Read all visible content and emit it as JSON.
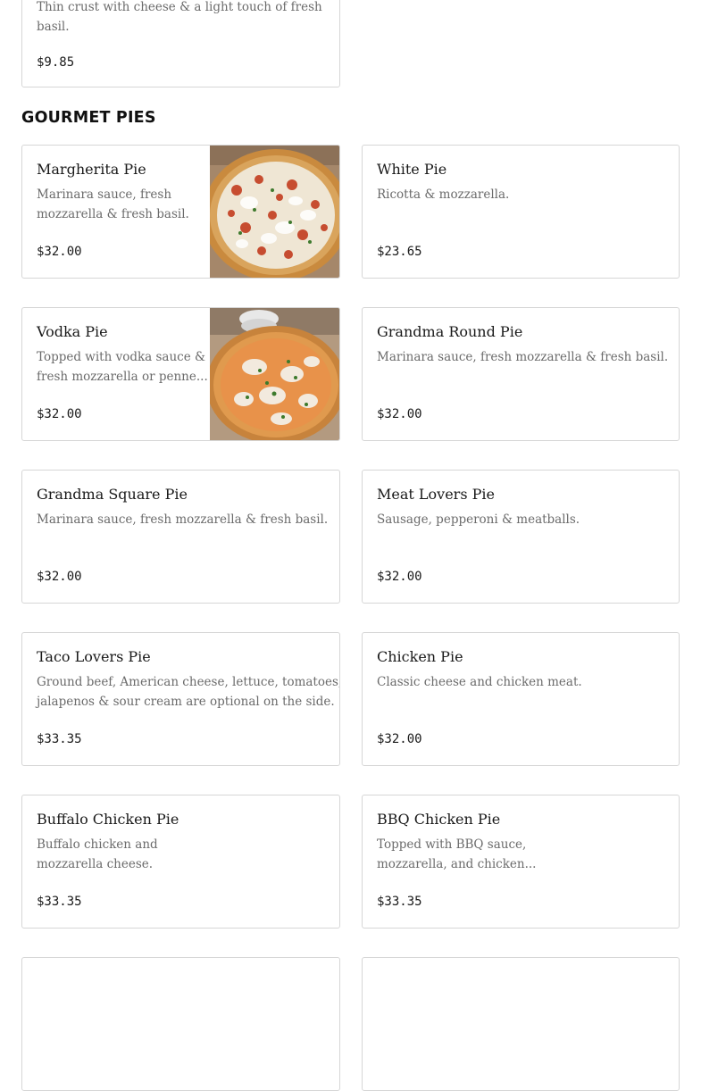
{
  "section": {
    "title": "GOURMET PIES"
  },
  "top_card": {
    "description_line1": "Thin crust with cheese & a light touch of fresh",
    "description_line2": "basil.",
    "price": "$9.85"
  },
  "items": [
    {
      "name": "Margherita Pie",
      "desc1": "Marinara sauce, fresh",
      "desc2": "mozzarella & fresh basil.",
      "price": "$32.00",
      "image": "margherita-pizza-photo"
    },
    {
      "name": "White Pie",
      "desc1": "Ricotta & mozzarella.",
      "desc2": "",
      "price": "$23.65"
    },
    {
      "name": "Vodka Pie",
      "desc1": "Topped with vodka sauce &",
      "desc2": "fresh mozzarella or penne...",
      "price": "$32.00",
      "image": "vodka-pizza-photo"
    },
    {
      "name": "Grandma Round Pie",
      "desc1": "Marinara sauce, fresh mozzarella & fresh basil.",
      "desc2": "",
      "price": "$32.00"
    },
    {
      "name": "Grandma Square Pie",
      "desc1": "Marinara sauce, fresh mozzarella & fresh basil.",
      "desc2": "",
      "price": "$32.00"
    },
    {
      "name": "Meat Lovers Pie",
      "desc1": "Sausage, pepperoni & meatballs.",
      "desc2": "",
      "price": "$32.00"
    },
    {
      "name": "Taco Lovers Pie",
      "desc1": "Ground beef, American cheese, lettuce, tomatoes,",
      "desc2": "jalapenos & sour cream are optional on the side.",
      "price": "$33.35"
    },
    {
      "name": "Chicken Pie",
      "desc1": "Classic cheese and chicken meat.",
      "desc2": "",
      "price": "$32.00"
    },
    {
      "name": "Buffalo Chicken Pie",
      "desc1": "Buffalo chicken and",
      "desc2": "mozzarella cheese.",
      "price": "$33.35"
    },
    {
      "name": "BBQ Chicken Pie",
      "desc1": "Topped with BBQ sauce,",
      "desc2": "mozzarella, and chicken...",
      "price": "$33.35"
    }
  ],
  "colors": {
    "border": "#d6d6d6",
    "text": "#191919",
    "muted_text": "#6b6b6b",
    "background": "#ffffff"
  }
}
